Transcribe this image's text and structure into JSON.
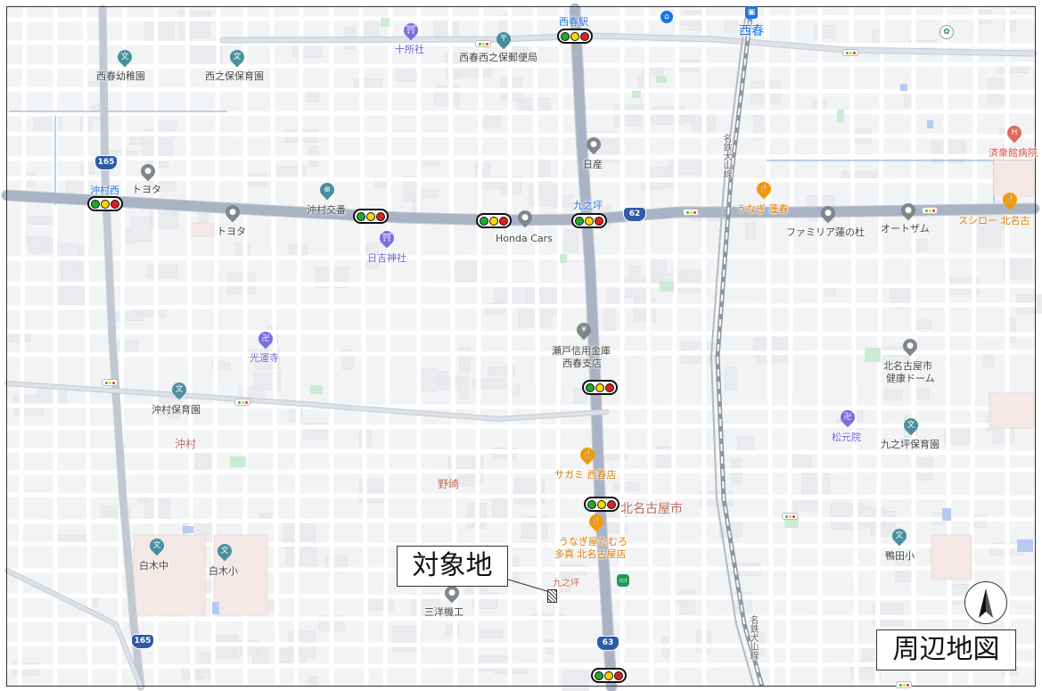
{
  "map": {
    "title": "周辺地図",
    "target_label": "対象地",
    "areas": [
      {
        "text": "沖村",
        "style": "brown"
      },
      {
        "text": "野崎",
        "style": "brown"
      },
      {
        "text": "北名古屋市",
        "style": "brownbig"
      },
      {
        "text": "九之坪",
        "style": "brown"
      },
      {
        "text": "西春",
        "style": "station"
      }
    ],
    "places": [
      {
        "text": "西春幼稚園",
        "style": "",
        "icon": "文",
        "color": "teal"
      },
      {
        "text": "西之保保育園",
        "style": "",
        "icon": "文",
        "color": "teal"
      },
      {
        "text": "十所社",
        "style": "purple",
        "icon": "⛩",
        "color": "purple"
      },
      {
        "text": "西春西之保郵便局",
        "style": "",
        "icon": "〒",
        "color": "teal"
      },
      {
        "text": "西春駅",
        "style": "blue",
        "icon": "",
        "color": ""
      },
      {
        "text": "済衆館病院",
        "style": "red",
        "icon": "H",
        "color": "red"
      },
      {
        "text": "沖村西",
        "style": "blue",
        "icon": "",
        "color": ""
      },
      {
        "text": "トヨタ",
        "style": "",
        "icon": "●",
        "color": "gray"
      },
      {
        "text": "沖村交番",
        "style": "",
        "icon": "⊗",
        "color": "teal"
      },
      {
        "text": "トヨタ",
        "style": "",
        "icon": "●",
        "color": "gray"
      },
      {
        "text": "日吉神社",
        "style": "purple",
        "icon": "⛩",
        "color": "purple"
      },
      {
        "text": "Honda Cars",
        "style": "",
        "icon": "●",
        "color": "gray"
      },
      {
        "text": "日産",
        "style": "",
        "icon": "●",
        "color": "gray"
      },
      {
        "text": "九之坪",
        "style": "blue",
        "icon": "",
        "color": ""
      },
      {
        "text": "うなぎ 蓬春",
        "style": "orange",
        "icon": "🍴",
        "color": "orange"
      },
      {
        "text": "ファミリア蓮の杜",
        "style": "",
        "icon": "●",
        "color": "gray"
      },
      {
        "text": "オートザム",
        "style": "",
        "icon": "●",
        "color": "gray"
      },
      {
        "text": "スシロー 北名古",
        "style": "orange",
        "icon": "🍴",
        "color": "orange"
      },
      {
        "text": "光運寺",
        "style": "purple",
        "icon": "卍",
        "color": "purple"
      },
      {
        "text": "瀬戸信用金庫",
        "style": "",
        "icon": "¥",
        "color": "gray"
      },
      {
        "text": "西春支店",
        "style": "",
        "icon": "",
        "color": ""
      },
      {
        "text": "北名古屋市",
        "style": "",
        "icon": "●",
        "color": "gray"
      },
      {
        "text": "健康ドーム",
        "style": "",
        "icon": "",
        "color": ""
      },
      {
        "text": "沖村保育園",
        "style": "",
        "icon": "文",
        "color": "teal"
      },
      {
        "text": "松元院",
        "style": "purple",
        "icon": "卍",
        "color": "purple"
      },
      {
        "text": "九之坪保育園",
        "style": "",
        "icon": "文",
        "color": "teal"
      },
      {
        "text": "サガミ 西春店",
        "style": "orange",
        "icon": "🍴",
        "color": "orange"
      },
      {
        "text": "うなぎ屋たむろ",
        "style": "orange",
        "icon": "🍴",
        "color": "orange"
      },
      {
        "text": "多真 北名古屋店",
        "style": "orange",
        "icon": "",
        "color": ""
      },
      {
        "text": "白木中",
        "style": "",
        "icon": "文",
        "color": "teal"
      },
      {
        "text": "白木小",
        "style": "",
        "icon": "文",
        "color": "teal"
      },
      {
        "text": "鴨田小",
        "style": "",
        "icon": "文",
        "color": "teal"
      },
      {
        "text": "三洋機工",
        "style": "",
        "icon": "●",
        "color": "gray"
      }
    ],
    "shields": [
      "165",
      "62",
      "165",
      "63"
    ],
    "railway_labels": [
      "名鉄犬山線",
      "名鉄犬山線"
    ]
  }
}
